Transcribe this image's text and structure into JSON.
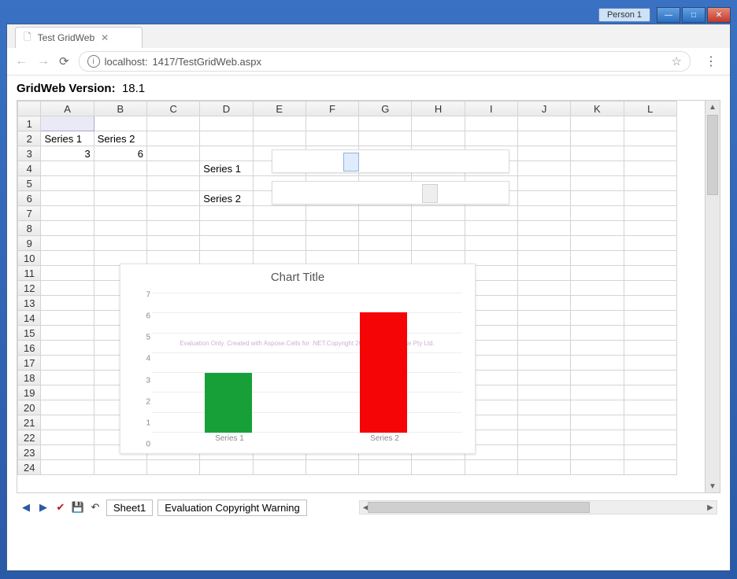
{
  "titlebar": {
    "person_badge": "Person 1"
  },
  "browser": {
    "tab_title": "Test GridWeb",
    "url_host": "localhost:",
    "url_port_path": "1417/TestGridWeb.aspx"
  },
  "page": {
    "version_label": "GridWeb Version:",
    "version_value": "18.1"
  },
  "grid": {
    "columns": [
      "A",
      "B",
      "C",
      "D",
      "E",
      "F",
      "G",
      "H",
      "I",
      "J",
      "K",
      "L"
    ],
    "row_count": 24,
    "cells": {
      "A2": "Series 1",
      "B2": "Series 2",
      "A3": "3",
      "B3": "6",
      "D4": "Series 1",
      "D6": "Series 2"
    },
    "selected_cell": "A1"
  },
  "chart_data": {
    "type": "bar",
    "title": "Chart Title",
    "categories": [
      "Series 1",
      "Series 2"
    ],
    "values": [
      3,
      6
    ],
    "colors": [
      "#17a038",
      "#f50505"
    ],
    "ylim": [
      0,
      7
    ],
    "yticks": [
      0,
      1,
      2,
      3,
      4,
      5,
      6,
      7
    ],
    "xlabel": "",
    "ylabel": "",
    "watermark": "Evaluation Only. Created with Aspose.Cells for .NET.Copyright 2003 - 2018 Aspose Pty Ltd."
  },
  "footer": {
    "sheet_tabs": [
      "Sheet1",
      "Evaluation Copyright Warning"
    ]
  }
}
